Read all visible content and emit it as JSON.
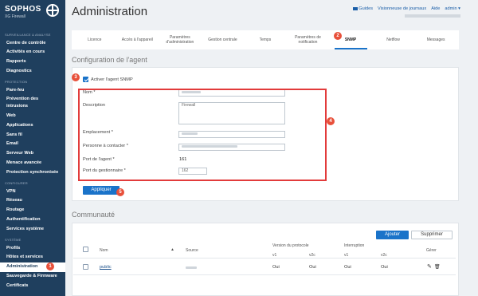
{
  "sidebar": {
    "brand": {
      "name": "SOPHOS",
      "product": "XG Firewall"
    },
    "sections": [
      {
        "heading": "SURVEILLANCE & ANALYSE",
        "items": [
          {
            "label": "Centre de contrôle"
          },
          {
            "label": "Activités en cours"
          },
          {
            "label": "Rapports"
          },
          {
            "label": "Diagnostics"
          }
        ]
      },
      {
        "heading": "PROTECTION",
        "items": [
          {
            "label": "Pare-feu"
          },
          {
            "label": "Prévention des intrusions"
          },
          {
            "label": "Web"
          },
          {
            "label": "Applications"
          },
          {
            "label": "Sans fil"
          },
          {
            "label": "Email"
          },
          {
            "label": "Serveur Web"
          },
          {
            "label": "Menace avancée"
          },
          {
            "label": "Protection synchronisée"
          }
        ]
      },
      {
        "heading": "CONFIGURER",
        "items": [
          {
            "label": "VPN"
          },
          {
            "label": "Réseau"
          },
          {
            "label": "Routage"
          },
          {
            "label": "Authentification"
          },
          {
            "label": "Services système"
          }
        ]
      },
      {
        "heading": "SYSTÈME",
        "items": [
          {
            "label": "Profils"
          },
          {
            "label": "Hôtes et services"
          },
          {
            "label": "Administration",
            "active": true
          },
          {
            "label": "Sauvegarde & Firmware"
          },
          {
            "label": "Certificats"
          }
        ]
      }
    ]
  },
  "header": {
    "title": "Administration",
    "links": [
      "Guides",
      "Visionneuse de journaux",
      "Aide",
      "admin ▾"
    ]
  },
  "tabs": [
    {
      "label": "Licence"
    },
    {
      "label": "Accès à l'appareil"
    },
    {
      "label": "Paramètres d'administration"
    },
    {
      "label": "Gestion centrale"
    },
    {
      "label": "Temps"
    },
    {
      "label": "Paramètres de notification"
    },
    {
      "label": "SNMP",
      "active": true
    },
    {
      "label": "Netflow"
    },
    {
      "label": "Messages"
    }
  ],
  "agent_config": {
    "section_title": "Configuration de l'agent",
    "enable_label": "Activer l'agent SNMP",
    "enabled": true,
    "fields": {
      "name_label": "Nom *",
      "description_label": "Description",
      "description_value": "Firewall",
      "location_label": "Emplacement *",
      "contact_label": "Personne à contacter *",
      "agent_port_label": "Port de l'agent *",
      "agent_port_value": "161",
      "manager_port_label": "Port du gestionnaire *",
      "manager_port_value": "162"
    },
    "apply_label": "Appliquer"
  },
  "community": {
    "section_title": "Communauté",
    "add_label": "Ajouter",
    "delete_label": "Supprimer",
    "columns": {
      "name": "Nom",
      "source": "Source",
      "protocol_version": "Version du protocole",
      "interruption": "Interruption",
      "v1": "v1",
      "v2c": "v2c",
      "manage": "Gérer"
    },
    "rows": [
      {
        "name": "public",
        "proto_v1": "Oui",
        "proto_v2c": "Oui",
        "int_v1": "Oui",
        "int_v2c": "Oui"
      }
    ]
  },
  "markers": [
    "1",
    "2",
    "3",
    "4",
    "5"
  ],
  "colors": {
    "sidebar": "#1f3f5e",
    "accent": "#1a73c9",
    "highlight": "#e23b3b"
  }
}
